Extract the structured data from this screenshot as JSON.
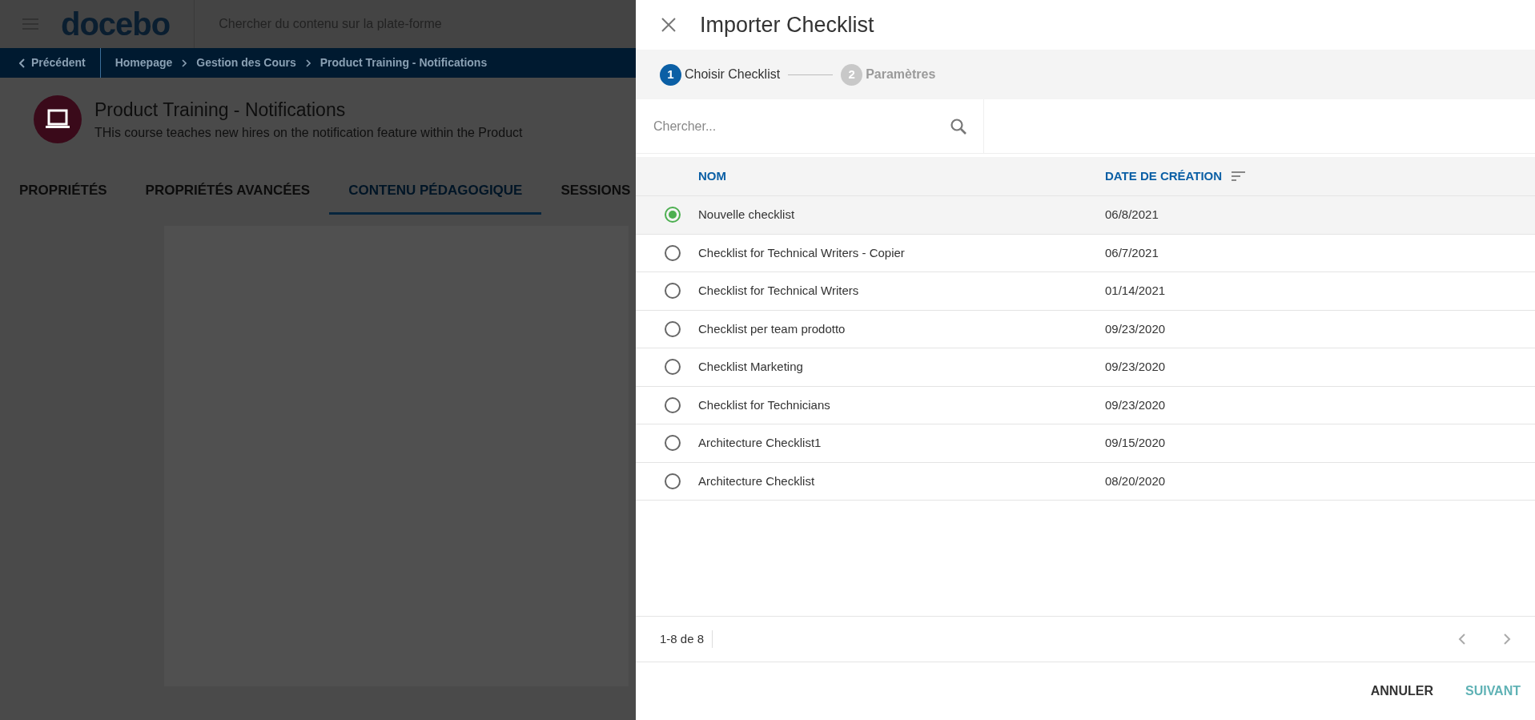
{
  "app_header": {
    "logo": "docebo",
    "search_placeholder": "Chercher du contenu sur la plate-forme"
  },
  "breadcrumb": {
    "back": "Précédent",
    "items": [
      "Homepage",
      "Gestion des Cours",
      "Product Training - Notifications"
    ]
  },
  "course": {
    "title": "Product Training - Notifications",
    "description": "THis course teaches new hires on the notification feature within the Product"
  },
  "tabs": [
    {
      "label": "PROPRIÉTÉS",
      "selected": false
    },
    {
      "label": "PROPRIÉTÉS AVANCÉES",
      "selected": false
    },
    {
      "label": "CONTENU PÉDAGOGIQUE",
      "selected": true
    },
    {
      "label": "SESSIONS",
      "selected": false
    }
  ],
  "dialog": {
    "title": "Importer Checklist",
    "steps": [
      {
        "number": "1",
        "label": "Choisir Checklist",
        "selected": true
      },
      {
        "number": "2",
        "label": "Paramètres",
        "selected": false
      }
    ],
    "search": {
      "placeholder": "Chercher..."
    },
    "table": {
      "columns": [
        "NOM",
        "DATE DE CRÉATION"
      ],
      "rows": [
        {
          "name": "Nouvelle checklist",
          "date": "06/8/2021",
          "selected": true
        },
        {
          "name": "Checklist for Technical Writers - Copier",
          "date": "06/7/2021",
          "selected": false
        },
        {
          "name": "Checklist for Technical Writers",
          "date": "01/14/2021",
          "selected": false
        },
        {
          "name": "Checklist per team prodotto",
          "date": "09/23/2020",
          "selected": false
        },
        {
          "name": "Checklist Marketing",
          "date": "09/23/2020",
          "selected": false
        },
        {
          "name": "Checklist for Technicians",
          "date": "09/23/2020",
          "selected": false
        },
        {
          "name": "Architecture Checklist1",
          "date": "09/15/2020",
          "selected": false
        },
        {
          "name": "Architecture Checklist",
          "date": "08/20/2020",
          "selected": false
        }
      ]
    },
    "pagination": "1-8 de 8",
    "buttons": [
      {
        "label": "ANNULER",
        "kind": "secondary"
      },
      {
        "label": "SUIVANT",
        "kind": "primary"
      }
    ]
  }
}
